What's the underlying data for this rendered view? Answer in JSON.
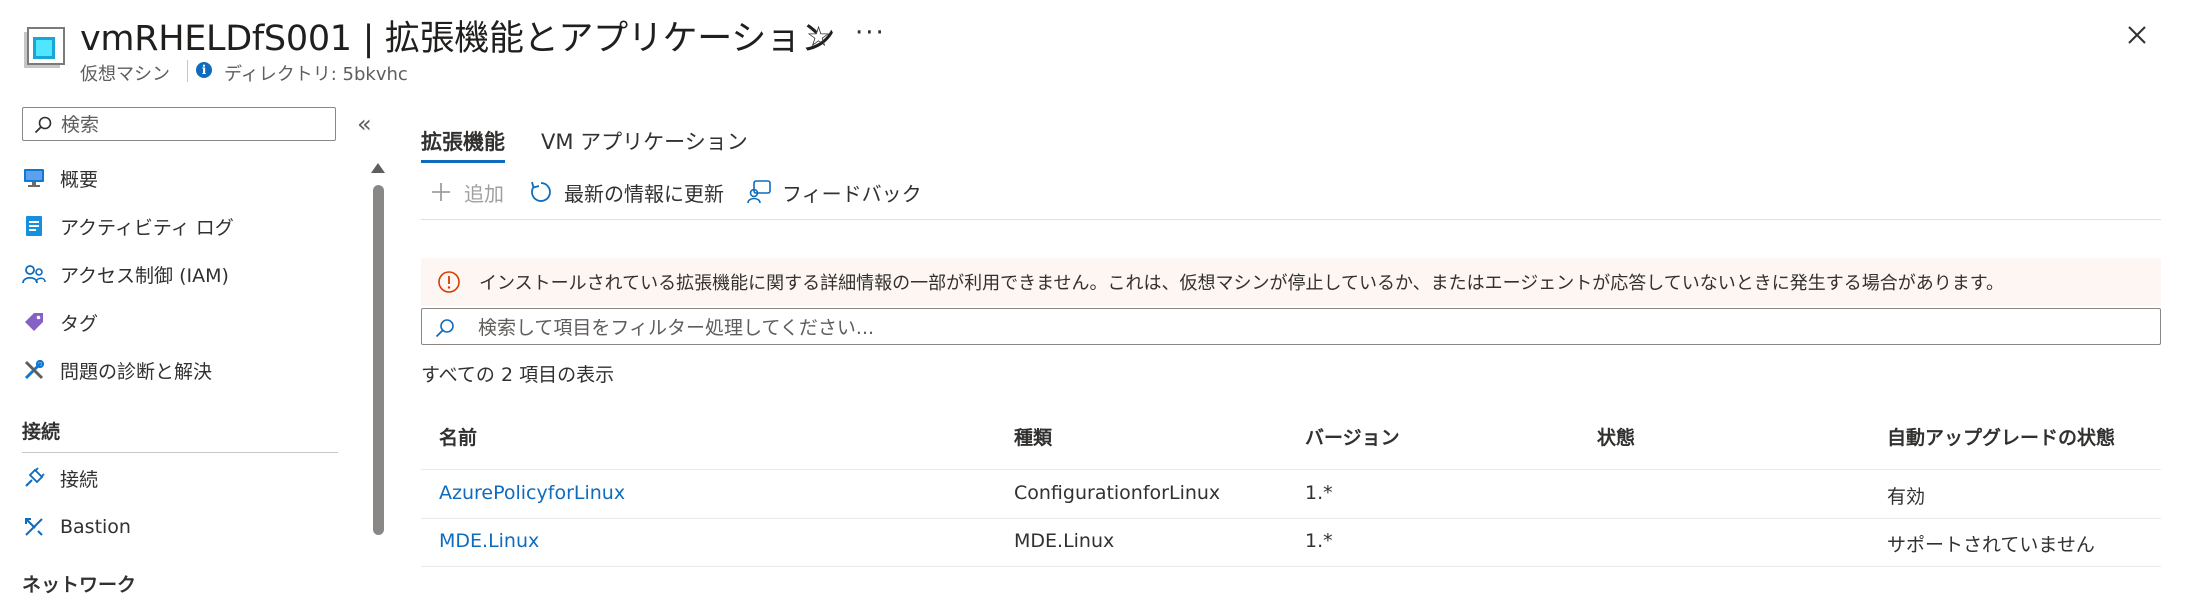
{
  "header": {
    "title": "vmRHELDfS001 | 拡張機能とアプリケーション",
    "subtitle": "仮想マシン",
    "directory": "ディレクトリ: 5bkvhc",
    "star_icon": "☆",
    "more_icon": "···"
  },
  "sidebar": {
    "search_placeholder": "検索",
    "collapse_icon": "«",
    "items": [
      {
        "label": "概要",
        "icon": "monitor-icon"
      },
      {
        "label": "アクティビティ ログ",
        "icon": "activity-log-icon"
      },
      {
        "label": "アクセス制御 (IAM)",
        "icon": "people-icon"
      },
      {
        "label": "タグ",
        "icon": "tag-icon"
      },
      {
        "label": "問題の診断と解決",
        "icon": "wrench-icon"
      }
    ],
    "section_connect": "接続",
    "connect_items": [
      {
        "label": "接続",
        "icon": "plug-icon"
      },
      {
        "label": "Bastion",
        "icon": "bastion-icon"
      }
    ],
    "section_network": "ネットワーク"
  },
  "tabs": [
    {
      "label": "拡張機能",
      "active": true
    },
    {
      "label": "VM アプリケーション",
      "active": false
    }
  ],
  "toolbar": {
    "add_label": "追加",
    "refresh_label": "最新の情報に更新",
    "feedback_label": "フィードバック"
  },
  "warning": {
    "text": "インストールされている拡張機能に関する詳細情報の一部が利用できません。これは、仮想マシンが停止しているか、またはエージェントが応答していないときに発生する場合があります。"
  },
  "filter": {
    "placeholder": "検索して項目をフィルター処理してください..."
  },
  "count_text": "すべての 2 項目の表示",
  "table": {
    "columns": [
      "名前",
      "種類",
      "バージョン",
      "状態",
      "自動アップグレードの状態"
    ],
    "rows": [
      {
        "name": "AzurePolicyforLinux",
        "type": "ConfigurationforLinux",
        "version": "1.*",
        "status": "",
        "auto_upgrade": "有効"
      },
      {
        "name": "MDE.Linux",
        "type": "MDE.Linux",
        "version": "1.*",
        "status": "",
        "auto_upgrade": "サポートされていません"
      }
    ]
  },
  "colors": {
    "accent": "#0f6cbd",
    "warning_bg": "#fdf6f3",
    "warning_icon": "#d83b01"
  }
}
